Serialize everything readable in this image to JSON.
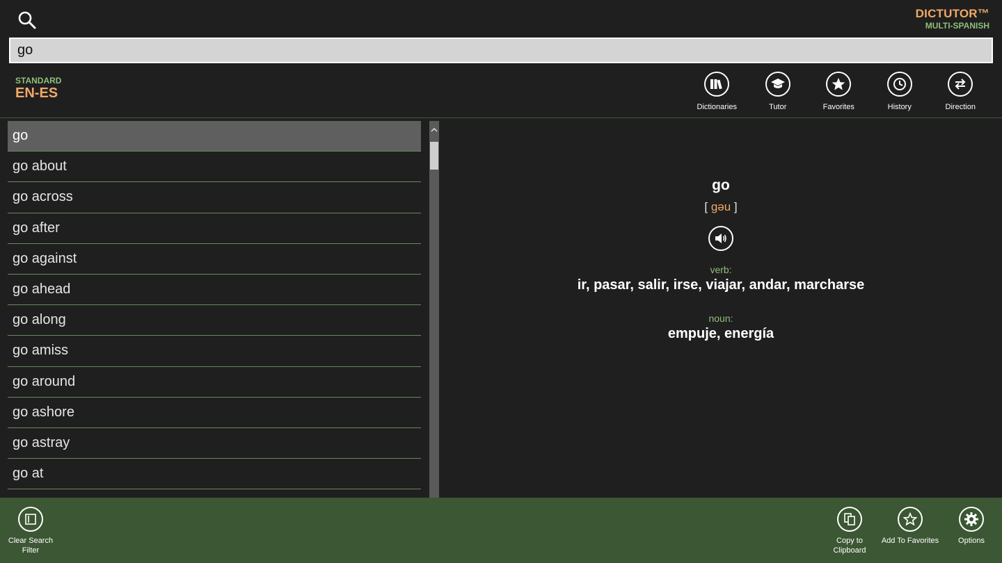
{
  "app": {
    "title": "DICTUTOR™",
    "subtitle": "MULTI-SPANISH"
  },
  "search": {
    "value": "go",
    "icon": "search-icon"
  },
  "mode": {
    "label": "STANDARD",
    "pair": "EN-ES"
  },
  "toolbar": {
    "items": [
      {
        "label": "Dictionaries",
        "icon": "books-icon"
      },
      {
        "label": "Tutor",
        "icon": "graduation-cap-icon"
      },
      {
        "label": "Favorites",
        "icon": "star-icon"
      },
      {
        "label": "History",
        "icon": "clock-icon"
      },
      {
        "label": "Direction",
        "icon": "swap-arrows-icon"
      }
    ]
  },
  "word_list": {
    "selected_index": 0,
    "items": [
      "go",
      "go about",
      "go across",
      "go after",
      "go against",
      "go ahead",
      "go along",
      "go amiss",
      "go around",
      "go ashore",
      "go astray",
      "go at"
    ]
  },
  "entry": {
    "headword": "go",
    "phonetic_open": "[",
    "phonetic": "gəu",
    "phonetic_close": "]",
    "senses": [
      {
        "pos": "verb:",
        "translations": "ir, pasar, salir, irse, viajar, andar, marcharse"
      },
      {
        "pos": "noun:",
        "translations": "empuje, energía"
      }
    ]
  },
  "appbar": {
    "clear_filter": "Clear Search Filter",
    "copy": "Copy to Clipboard",
    "add_favorites": "Add To Favorites",
    "options": "Options"
  },
  "colors": {
    "accent_orange": "#f0a868",
    "accent_green": "#8fbf7a",
    "appbar_bg": "#3c5733",
    "background": "#1f1f1f"
  }
}
